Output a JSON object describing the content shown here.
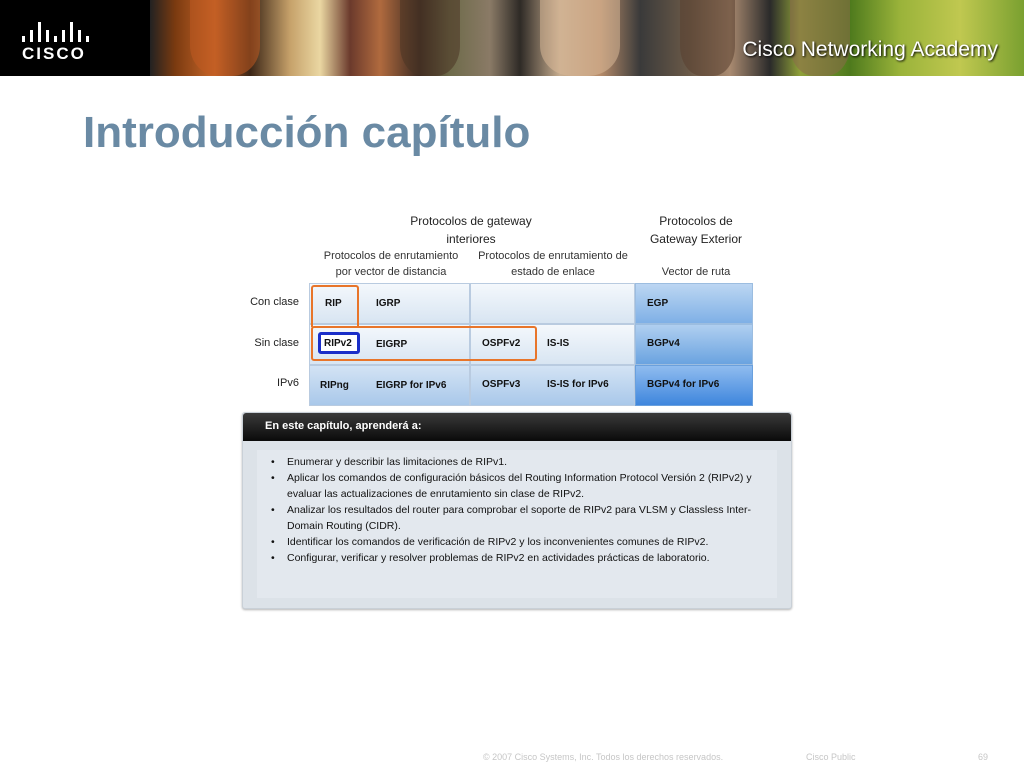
{
  "header": {
    "logo_text": "CISCO",
    "academy_text": "Cisco Networking Academy"
  },
  "title": "Introducción capítulo",
  "diagram": {
    "igp_header": "Protocolos de gateway interiores",
    "egp_header": "Protocolos de Gateway Exterior",
    "dv_sub": "Protocolos de enrutamiento por vector de distancia",
    "ls_sub": "Protocolos de enrutamiento de estado de enlace",
    "pv_sub": "Vector de ruta",
    "rows": [
      "Con clase",
      "Sin clase",
      "IPv6"
    ],
    "cells": {
      "rip": "RIP",
      "igrp": "IGRP",
      "egp": "EGP",
      "ripv2": "RIPv2",
      "eigrp": "EIGRP",
      "ospfv2": "OSPFv2",
      "isis": "IS-IS",
      "bgpv4": "BGPv4",
      "ripng": "RIPng",
      "eigrp6": "EIGRP for IPv6",
      "ospfv3": "OSPFv3",
      "isis6": "IS-IS for IPv6",
      "bgpv46": "BGPv4 for IPv6"
    }
  },
  "panel": {
    "heading": "En este capítulo, aprenderá a:",
    "bullets": [
      "Enumerar y describir las limitaciones de RIPv1.",
      "Aplicar los comandos de configuración básicos del Routing Information Protocol Versión 2 (RIPv2) y evaluar las actualizaciones de enrutamiento sin clase de RIPv2.",
      "Analizar los resultados del router para comprobar el soporte de RIPv2 para VLSM y Classless Inter-Domain Routing (CIDR).",
      "Identificar los comandos de verificación de RIPv2 y los inconvenientes comunes de RIPv2.",
      "Configurar, verificar y resolver problemas de RIPv2 en actividades prácticas de laboratorio."
    ]
  },
  "footer": {
    "copyright": "© 2007 Cisco Systems, Inc. Todos los derechos reservados.",
    "classification": "Cisco Public",
    "page": "69"
  }
}
